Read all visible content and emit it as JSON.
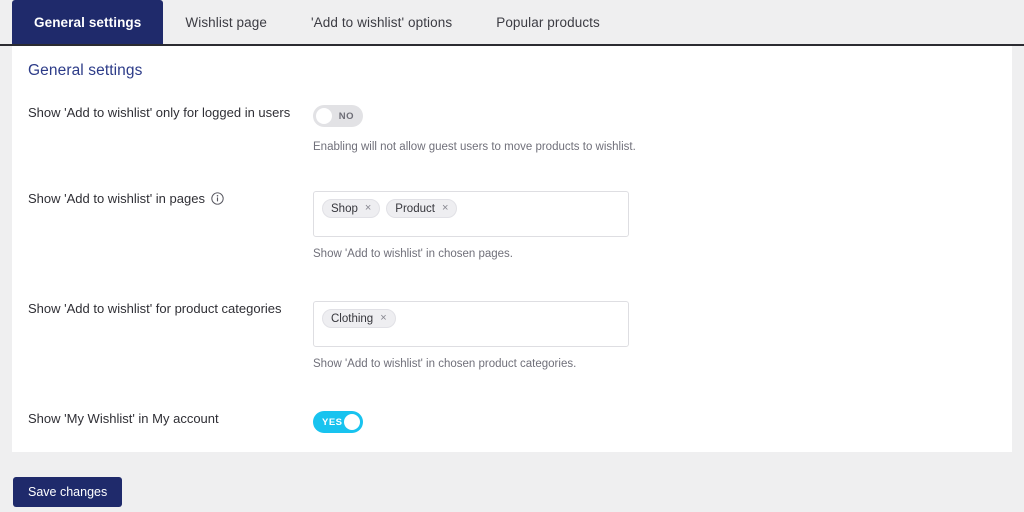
{
  "tabs": [
    {
      "label": "General settings",
      "active": true
    },
    {
      "label": "Wishlist page",
      "active": false
    },
    {
      "label": "'Add to wishlist' options",
      "active": false
    },
    {
      "label": "Popular products",
      "active": false
    }
  ],
  "panel": {
    "title": "General settings"
  },
  "rows": {
    "logged_in": {
      "label": "Show 'Add to wishlist' only for logged in users",
      "toggle_value": "NO",
      "toggle_state": "off",
      "helper": "Enabling will not allow guest users to move products to wishlist."
    },
    "pages": {
      "label": "Show 'Add to wishlist' in pages",
      "info_icon": "info-icon",
      "tags": [
        "Shop",
        "Product"
      ],
      "remove_glyph": "×",
      "helper": "Show 'Add to wishlist' in chosen pages."
    },
    "categories": {
      "label": "Show 'Add to wishlist' for product categories",
      "tags": [
        "Clothing"
      ],
      "remove_glyph": "×",
      "helper": "Show 'Add to wishlist' in chosen product categories."
    },
    "my_wishlist": {
      "label": "Show 'My Wishlist' in My account",
      "toggle_value": "YES",
      "toggle_state": "on"
    }
  },
  "footer": {
    "save_label": "Save changes"
  },
  "colors": {
    "brand_navy": "#1f2a6b",
    "heading_blue": "#2c3b88",
    "toggle_on": "#18c3ef",
    "toggle_off": "#e2e2e5",
    "page_bg": "#efeff0",
    "panel_bg": "#ffffff"
  }
}
